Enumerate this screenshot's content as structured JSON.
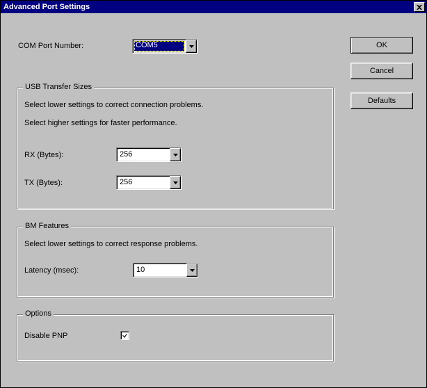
{
  "title": "Advanced Port Settings",
  "buttons": {
    "ok": "OK",
    "cancel": "Cancel",
    "defaults": "Defaults"
  },
  "com_port": {
    "label": "COM Port Number:",
    "value": "COM5"
  },
  "usb": {
    "legend": "USB Transfer Sizes",
    "hint1": "Select lower settings to correct connection problems.",
    "hint2": "Select higher settings for faster performance.",
    "rx_label": "RX (Bytes):",
    "rx_value": "256",
    "tx_label": "TX (Bytes):",
    "tx_value": "256"
  },
  "bm": {
    "legend": "BM Features",
    "hint": "Select lower settings to correct response problems.",
    "latency_label": "Latency (msec):",
    "latency_value": "10"
  },
  "options": {
    "legend": "Options",
    "disable_pnp_label": "Disable PNP",
    "disable_pnp_checked": true
  }
}
